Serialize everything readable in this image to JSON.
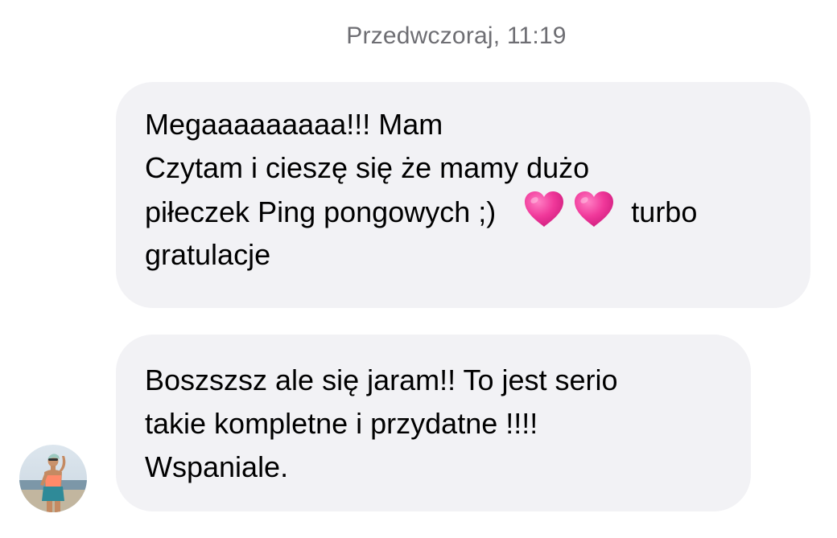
{
  "conversation": {
    "timestamp": "Przedwczoraj, 11:19",
    "messages": [
      {
        "lines": [
          "Megaaaaaaaaa!!! Mam",
          "Czytam i cieszę się że mamy dużo",
          "piłeczek Ping pongowych ;)",
          "turbo",
          "gratulacje"
        ],
        "emoji": [
          "pink-heart",
          "pink-heart"
        ]
      },
      {
        "lines": [
          "Boszszsz ale się jaram!! To jest serio",
          "takie kompletne i przydatne !!!!",
          "Wspaniale."
        ]
      }
    ]
  },
  "colors": {
    "bubble_background": "#f2f2f5",
    "timestamp_text": "#6e6e73",
    "heart": "#f0389a"
  }
}
